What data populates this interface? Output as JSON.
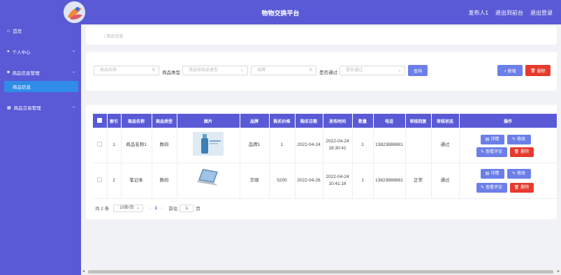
{
  "header": {
    "title": "物物交换平台",
    "user": "发布人1",
    "back_to_front": "退出到前台",
    "logout": "退出登录"
  },
  "sidebar": {
    "items": [
      {
        "label": "首页",
        "icon": "home-icon"
      },
      {
        "label": "个人中心",
        "icon": "user-icon"
      },
      {
        "label": "商品信息管理",
        "icon": "box-icon"
      },
      {
        "label": "商品信息",
        "icon": "none"
      },
      {
        "label": "商品交易管理",
        "icon": "grid-icon"
      }
    ]
  },
  "breadcrumb": {
    "text": "/ 商品信息"
  },
  "search": {
    "name_placeholder": "商品名称",
    "type_label": "商品类型",
    "type_placeholder": "请选择商品类型",
    "brand_placeholder": "品牌",
    "pass_label": "是否通过",
    "pass_placeholder": "是否通过",
    "search_button": "查询",
    "add_button": "+ 新增",
    "delete_button": "删除"
  },
  "table": {
    "columns": [
      "索引",
      "商品名称",
      "商品类型",
      "图片",
      "品牌",
      "购买价格",
      "购买日期",
      "发布时间",
      "数量",
      "电话",
      "审核回复",
      "审核状态",
      "操作"
    ],
    "rows": [
      {
        "index": "1",
        "name": "商品名称1",
        "type": "数码",
        "brand": "品牌1",
        "price": "1",
        "buy_date": "2022-04-24",
        "publish_time": "2022-04-24 18:30:41",
        "qty": "1",
        "phone": "13823888881",
        "reply": "",
        "status": "通过"
      },
      {
        "index": "2",
        "name": "笔记本",
        "type": "数码",
        "brand": "华硕",
        "price": "5200",
        "buy_date": "2022-04-26",
        "publish_time": "2022-04-24 10:41:16",
        "qty": "1",
        "phone": "13823888881",
        "reply": "正常",
        "status": "通过"
      }
    ],
    "ops": {
      "detail": "详情",
      "edit": "修改",
      "review": "查看评论",
      "delete": "删除"
    }
  },
  "pager": {
    "total": "共 2 条",
    "page_size": "10条/页",
    "current": "1",
    "goto": "前往",
    "goto_value": "1",
    "page_unit": "页"
  },
  "colors": {
    "primary": "#5a5ad6",
    "active": "#2f8ce8",
    "danger": "#e63a2e",
    "button": "#6c7fe8"
  }
}
